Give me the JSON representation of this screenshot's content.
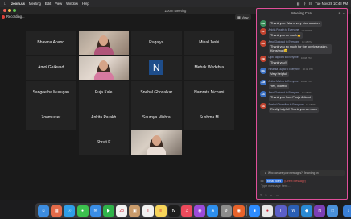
{
  "menubar": {
    "apple": "",
    "app_name": "zoom.us",
    "items": [
      "Meeting",
      "Edit",
      "View",
      "Window",
      "Help"
    ],
    "clock": "Tue Nov 28  10:48 PM"
  },
  "window": {
    "title": "Zoom Meeting",
    "recording_label": "Recording...",
    "view_label": "View"
  },
  "participants": [
    {
      "name": "Bhawna Anand",
      "type": "name"
    },
    {
      "name": "",
      "type": "photo",
      "variant": "p1",
      "active": true
    },
    {
      "name": "Ruqaiya",
      "type": "name"
    },
    {
      "name": "Minal Joshi",
      "type": "name"
    },
    {
      "name": "Amol Gaikwad",
      "type": "name"
    },
    {
      "name": "",
      "type": "photo",
      "variant": "p2"
    },
    {
      "name": "",
      "type": "avatar",
      "letter": "N"
    },
    {
      "name": "Mehak Wadehra",
      "type": "name"
    },
    {
      "name": "Sangeetha Murugan",
      "type": "name"
    },
    {
      "name": "Puja Kale",
      "type": "name"
    },
    {
      "name": "Snehal Ghosalkar",
      "type": "name"
    },
    {
      "name": "Namrata Nichani",
      "type": "name"
    },
    {
      "name": "Zoom user",
      "type": "name"
    },
    {
      "name": "Ankita Parakh",
      "type": "name"
    },
    {
      "name": "Saumya Mishra",
      "type": "name"
    },
    {
      "name": "Sushma M",
      "type": "name"
    },
    {
      "name": "",
      "type": "empty"
    },
    {
      "name": "Shruti K",
      "type": "name"
    },
    {
      "name": "",
      "type": "photo",
      "variant": "p3"
    },
    {
      "name": "",
      "type": "empty"
    }
  ],
  "chat": {
    "title": "Meeting Chat",
    "messages": [
      {
        "initials": "AM",
        "color": "#3a8f5c",
        "sender": "",
        "text": "Thank you. Was a very nice session.",
        "time": ""
      },
      {
        "initials": "AP",
        "color": "#c1432f",
        "sender": "Ankita Parakh to Everyone",
        "text": "Thank you so much👍",
        "time": "10:48 PM"
      },
      {
        "initials": "AG",
        "color": "#c1432f",
        "sender": "Amol Gaikwad to Everyone",
        "text": "Thank you so much for the lovely session, Kirushnali😊",
        "time": "10:48 PM"
      },
      {
        "initials": "DB",
        "color": "#c1432f",
        "sender": "Dipti Bapodra to Everyone",
        "text": "Thank you!!",
        "time": "10:48 PM"
      },
      {
        "initials": "NG",
        "color": "#3a6fc1",
        "sender": "Niharika Gupta to Everyone",
        "text": "Very helpful!",
        "time": "10:48 PM"
      },
      {
        "initials": "AM",
        "color": "#3a6fc1",
        "sender": "Aniket Mishra to Everyone",
        "text": "Yes, indeed!",
        "time": "10:48 PM"
      },
      {
        "initials": "AG",
        "color": "#3a6fc1",
        "sender": "Amol Gaikwad to Everyone",
        "text": "Thank you from Pooja & Amol",
        "time": "10:48 PM"
      },
      {
        "initials": "SG",
        "color": "#c1432f",
        "sender": "Snehal Ghosalkar to Everyone",
        "text": "Really helpful! Thank you so much",
        "time": "10:48 PM"
      }
    ],
    "notice": "Who can see your messages? Recording on",
    "to_label": "To:",
    "to_recipient": "Minal Joshi",
    "to_note": "(Direct Message)",
    "input_placeholder": "Type message here..."
  },
  "dock": {
    "icons": [
      {
        "name": "finder-icon",
        "color": "#3d8de0",
        "glyph": "☺"
      },
      {
        "name": "launchpad-icon",
        "color": "#e36b4a",
        "glyph": "▦"
      },
      {
        "name": "safari-icon",
        "color": "#2f9ee8",
        "glyph": "☉"
      },
      {
        "name": "messages-icon",
        "color": "#3cc14e",
        "glyph": "●"
      },
      {
        "name": "mail-icon",
        "color": "#3a8ee6",
        "glyph": "✉"
      },
      {
        "name": "facetime-icon",
        "color": "#2fb34a",
        "glyph": "▶"
      },
      {
        "name": "calendar-icon",
        "color": "#f2f2f2",
        "glyph": "28"
      },
      {
        "name": "contacts-icon",
        "color": "#c99b6b",
        "glyph": "▣"
      },
      {
        "name": "reminders-icon",
        "color": "#f0f0f0",
        "glyph": "≡"
      },
      {
        "name": "notes-icon",
        "color": "#f6d45a",
        "glyph": "≡"
      },
      {
        "name": "tv-icon",
        "color": "#1d1d1d",
        "glyph": "tv"
      },
      {
        "name": "music-icon",
        "color": "#ec4a5c",
        "glyph": "♫"
      },
      {
        "name": "podcasts-icon",
        "color": "#9b4bd9",
        "glyph": "◉"
      },
      {
        "name": "appstore-icon",
        "color": "#2e8fee",
        "glyph": "A"
      },
      {
        "name": "settings-icon",
        "color": "#8c8c8c",
        "glyph": "⚙"
      },
      {
        "name": "firefox-icon",
        "color": "#e8632b",
        "glyph": "◉"
      },
      {
        "name": "zoom-icon",
        "color": "#2d8cff",
        "glyph": "■"
      },
      {
        "name": "chrome-icon",
        "color": "#e8e8e8",
        "glyph": "●"
      },
      {
        "name": "teams-icon",
        "color": "#5b5fc7",
        "glyph": "T"
      },
      {
        "name": "word-icon",
        "color": "#2b5fb4",
        "glyph": "W"
      },
      {
        "name": "vscode-icon",
        "color": "#2a8ad4",
        "glyph": "◆"
      },
      {
        "name": "onenote-icon",
        "color": "#7b3fb5",
        "glyph": "N"
      },
      {
        "name": "preview-icon",
        "color": "#4a90d9",
        "glyph": "□"
      },
      {
        "name": "downloads-icon",
        "color": "#3a7fd6",
        "glyph": "↓"
      },
      {
        "name": "trash-icon",
        "color": "#9a9a9a",
        "glyph": "□"
      }
    ]
  }
}
